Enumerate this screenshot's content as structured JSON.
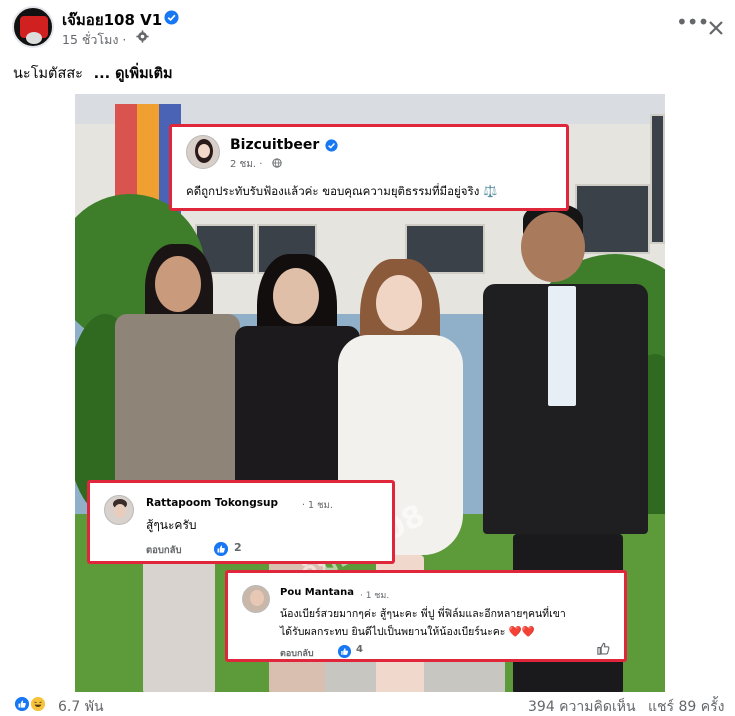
{
  "post": {
    "page_name": "เจ๊มอย108 V1",
    "time": "15 ชั่วโมง ·",
    "text": "นะโมตัสสะ",
    "see_more": "... ดูเพิ่มเติม",
    "icons": {
      "verified": "verified-badge-icon",
      "privacy": "gear-icon",
      "more": "more-icon",
      "close": "close-icon"
    }
  },
  "image": {
    "watermark": "เจ๊มอย108",
    "top_comment": {
      "name": "Bizcuitbeer",
      "meta": "2 ชม. ·",
      "text": "คดีถูกประทับรับฟ้องแล้วค่ะ ขอบคุณความยุติธรรมที่มีอยู่จริง ⚖️"
    },
    "comment_1": {
      "name": "Rattapoom Tokongsup",
      "meta": "· 1 ชม.",
      "text": "สู้ๆนะครับ",
      "reply": "ตอบกลับ",
      "likes": "2"
    },
    "comment_2": {
      "name": "Pou Mantana",
      "meta": "· 1 ชม.",
      "line1": "น้องเบียร์สวยมากๆค่ะ สู้ๆนะคะ พี่ปู พี่ฟิล์มและอีกหลายๆคนที่เขา",
      "line2": "ได้รับผลกระทบ ยินดีไปเป็นพยานให้น้องเบียร์นะคะ ❤️❤️",
      "reply": "ตอบกลับ",
      "likes": "4"
    }
  },
  "footer": {
    "reactions": "6.7 พัน",
    "comments": "394 ความคิดเห็น",
    "shares": "แชร์ 89 ครั้ง"
  },
  "colors": {
    "accent": "#1877f2",
    "highlight": "#e0263a",
    "muted": "#65676b"
  }
}
